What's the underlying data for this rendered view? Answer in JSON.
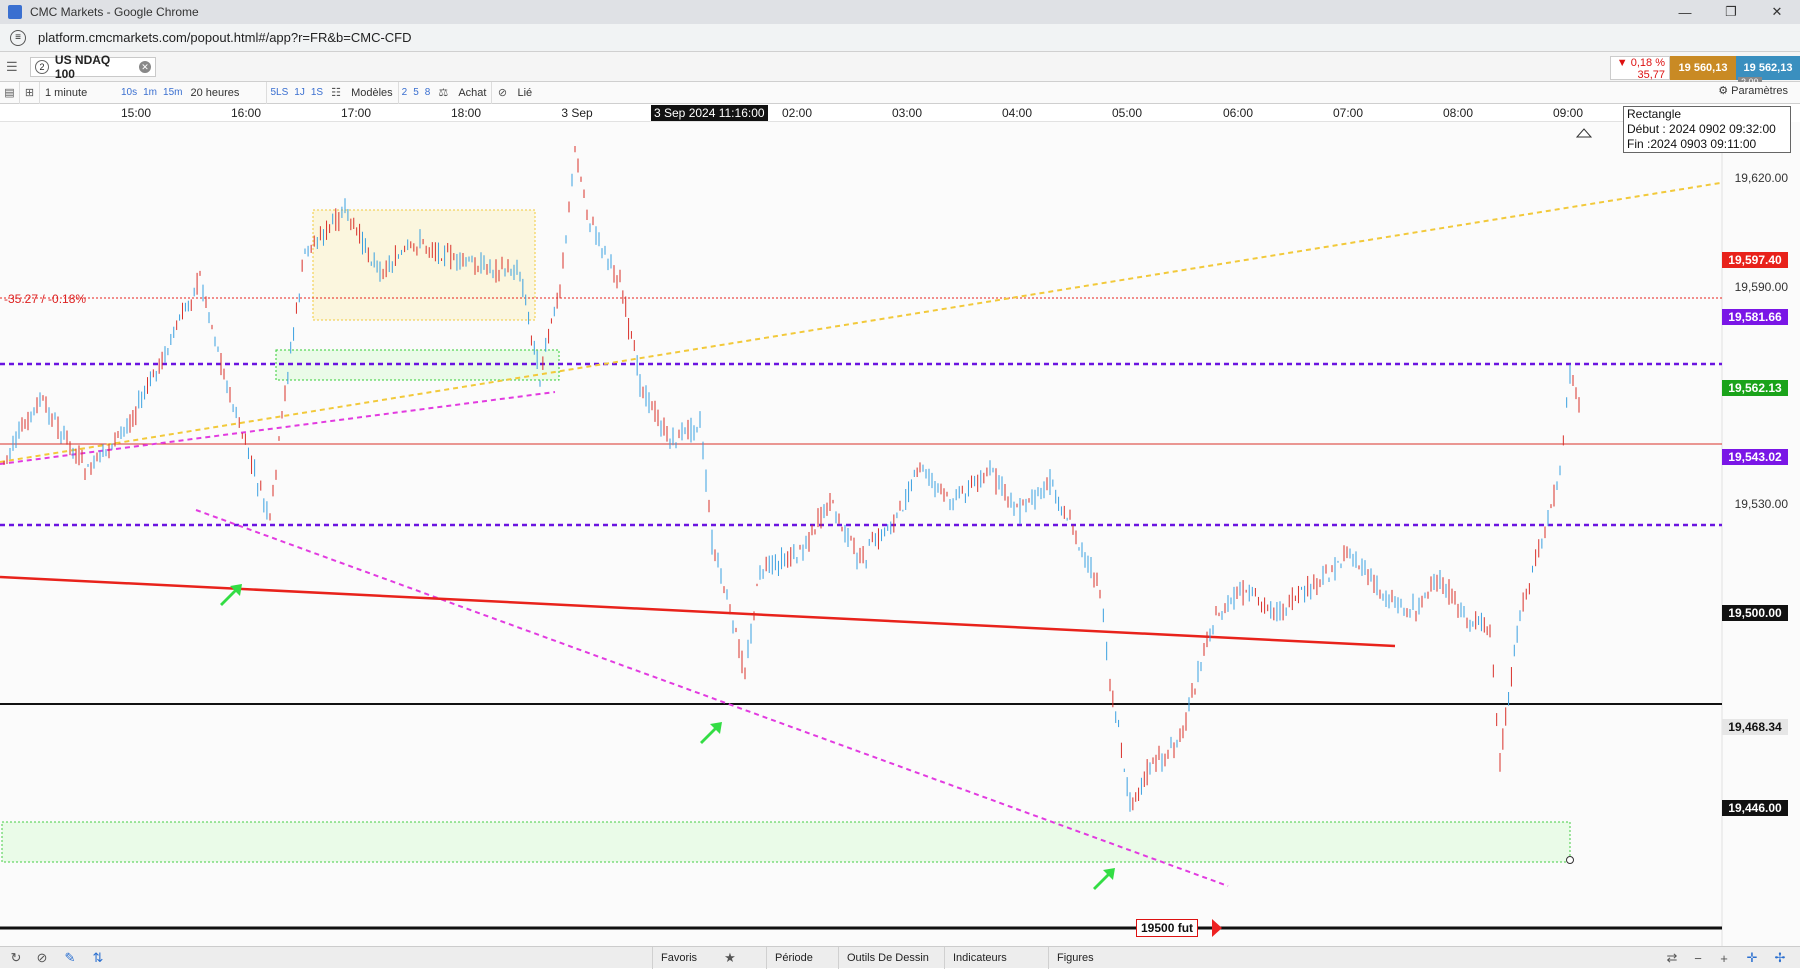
{
  "window": {
    "title": "CMC Markets - Google Chrome"
  },
  "address": {
    "url": "platform.cmcmarkets.com/popout.html#/app?r=FR&b=CMC-CFD"
  },
  "instrument": {
    "number": "2",
    "name": "US NDAQ 100"
  },
  "quote": {
    "change_pct": "▼ 0,18 %",
    "change_pts": "35,77",
    "sell": "19 560,13",
    "buy": "19 562,13",
    "spread": "2,00"
  },
  "toolbar": {
    "interval": "1 minute",
    "intervals": [
      "10s",
      "1m",
      "15m"
    ],
    "range": "20 heures",
    "ranges": [
      "5LS",
      "1J",
      "1S"
    ],
    "models": "Modèles",
    "sizes": [
      "2",
      "5",
      "8"
    ],
    "buy": "Achat",
    "linked": "Lié",
    "params": "Paramètres"
  },
  "time_axis": {
    "labels": [
      "15:00",
      "16:00",
      "17:00",
      "18:00",
      "3 Sep",
      "02:00",
      "03:00",
      "04:00",
      "05:00",
      "06:00",
      "07:00",
      "08:00",
      "09:00"
    ],
    "cursor": "3 Sep 2024 11:16:00"
  },
  "price_axis": {
    "labels": [
      "19,620.00",
      "19,590.00",
      "19,530.00"
    ]
  },
  "price_tags": {
    "prev_close": {
      "value": "19,597.40",
      "color": "#e8221b"
    },
    "level_upper": {
      "value": "19,581.66",
      "color": "#7a16e6"
    },
    "current": {
      "value": "19,562.13",
      "color": "#1aa31a"
    },
    "level_lower": {
      "value": "19,543.02",
      "color": "#7a16e6"
    },
    "round": {
      "value": "19,500.00",
      "color": "#111111"
    },
    "zone": {
      "value": "19,468.34",
      "color": "#e6e6e6"
    },
    "bottom": {
      "value": "19,446.00",
      "color": "#111111"
    }
  },
  "annotations": {
    "pct_change": "-35.27 / -0.18%",
    "futures_label": "19500 fut"
  },
  "rectangle_info": {
    "title": "Rectangle",
    "start": "Début : 2024 0902 09:32:00",
    "end": "Fin :2024 0903 09:11:00"
  },
  "bottom_bar": {
    "tabs": [
      "Favoris",
      "Période",
      "Outils De Dessin",
      "Indicateurs",
      "Figures"
    ]
  },
  "colors": {
    "bull": "#3aa0e0",
    "bear": "#d9302a",
    "dotted_purple": "#6a14e0",
    "magenta": "#e23be0",
    "yellow": "#f2d24a",
    "green_arrow": "#33dd44"
  }
}
